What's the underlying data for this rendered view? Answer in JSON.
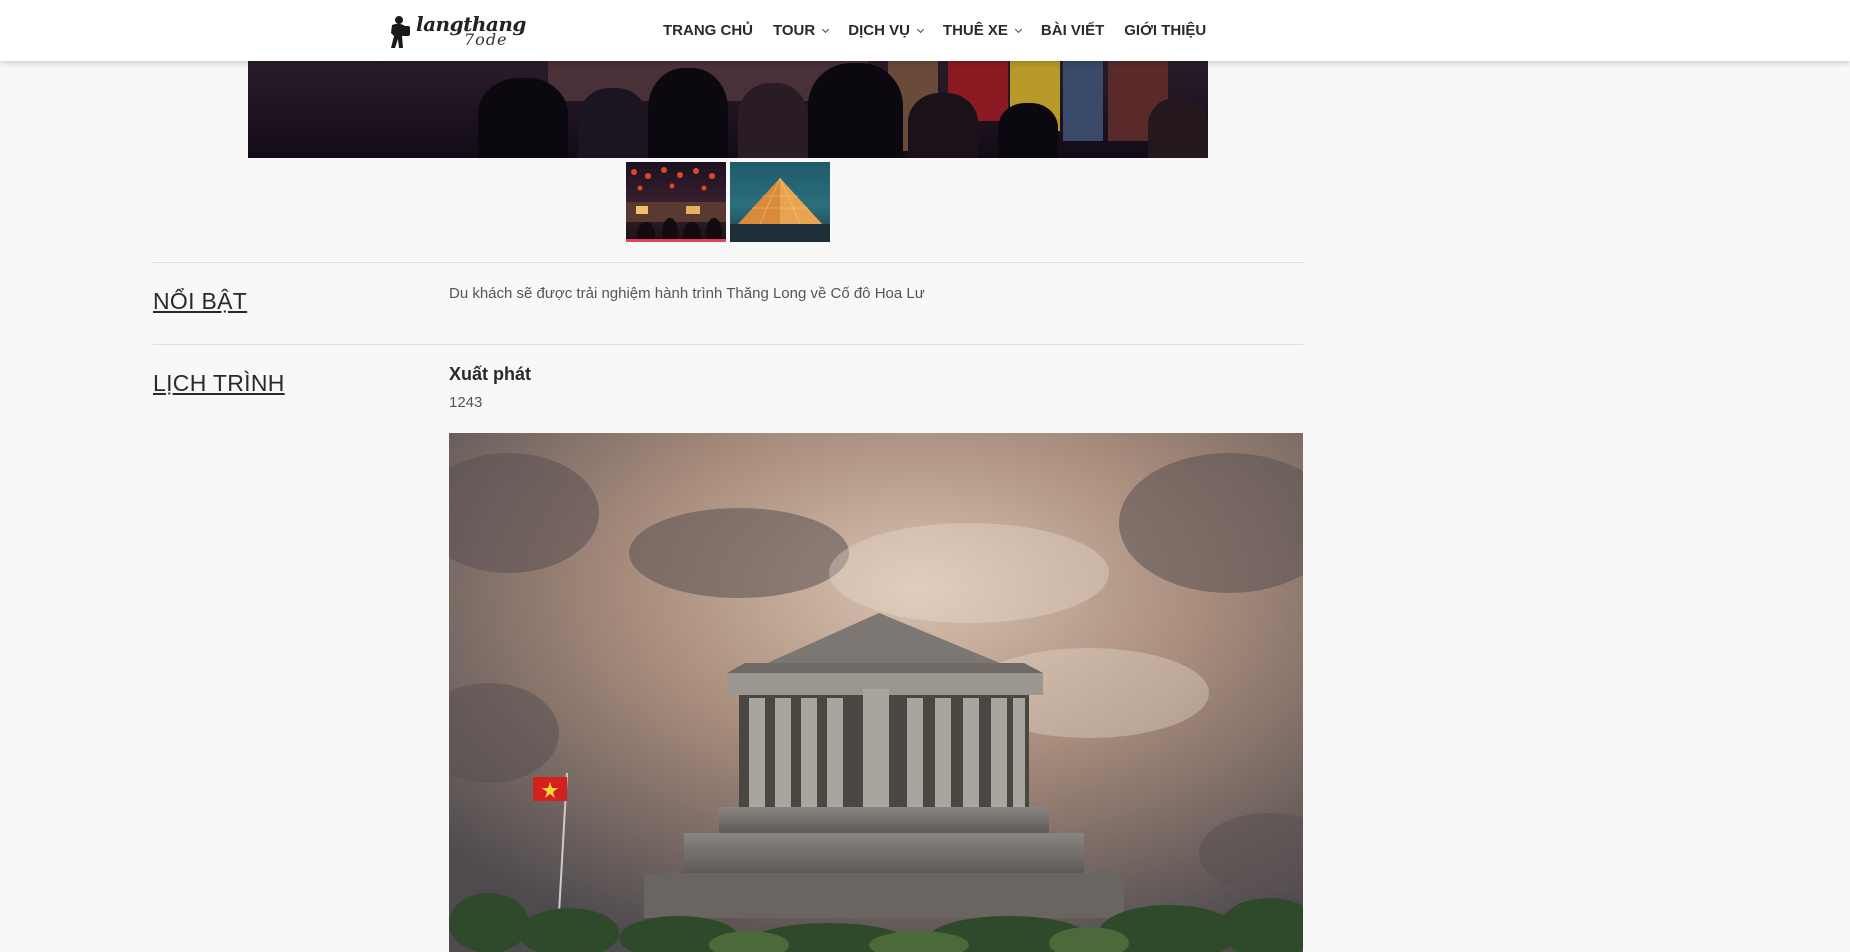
{
  "header": {
    "logo": {
      "line1": "langthang",
      "line2": "7ode"
    },
    "nav": [
      {
        "label": "TRANG CHỦ",
        "dropdown": false
      },
      {
        "label": "TOUR",
        "dropdown": true
      },
      {
        "label": "DỊCH VỤ",
        "dropdown": true
      },
      {
        "label": "THUÊ XE",
        "dropdown": true
      },
      {
        "label": "BÀI VIẾT",
        "dropdown": false
      },
      {
        "label": "GIỚI THIỆU",
        "dropdown": false
      }
    ]
  },
  "gallery": {
    "thumbnails": [
      {
        "name": "night-market",
        "active": true
      },
      {
        "name": "pyramid",
        "active": false
      }
    ]
  },
  "highlight": {
    "label": "NỔI BẬT",
    "text": "Du khách sẽ được trải nghiệm hành trình Thăng Long về Cố đô Hoa Lư"
  },
  "schedule": {
    "label": "LỊCH TRÌNH",
    "title": "Xuất phát",
    "value": "1243"
  },
  "colors": {
    "accent": "#e4405f",
    "background": "#f8f8f8",
    "text": "#2a2a2a"
  }
}
